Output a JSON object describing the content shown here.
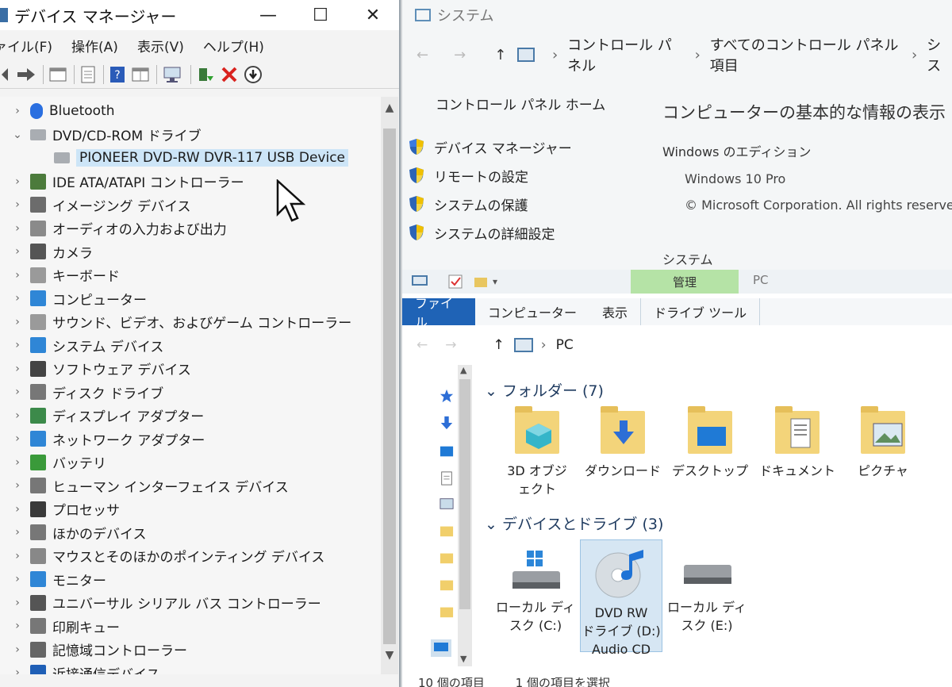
{
  "device_manager": {
    "title": "デバイス マネージャー",
    "window_buttons": {
      "minimize": "—",
      "maximize": "☐",
      "close": "✕"
    },
    "menu": [
      "ァイル(F)",
      "操作(A)",
      "表示(V)",
      "ヘルプ(H)"
    ],
    "tree_items": [
      {
        "label": "Bluetooth",
        "expanded": false,
        "icon": "bluetooth-icon"
      },
      {
        "label": "DVD/CD-ROM ドライブ",
        "expanded": true,
        "icon": "dvd-drive-icon"
      },
      {
        "label": "PIONEER DVD-RW  DVR-117 USB Device",
        "child": true,
        "selected": true,
        "icon": "dvd-drive-icon"
      },
      {
        "label": "IDE ATA/ATAPI コントローラー",
        "icon": "ide-controller-icon"
      },
      {
        "label": "イメージング デバイス",
        "icon": "imaging-device-icon"
      },
      {
        "label": "オーディオの入力および出力",
        "icon": "speaker-icon"
      },
      {
        "label": "カメラ",
        "icon": "camera-icon"
      },
      {
        "label": "キーボード",
        "icon": "keyboard-icon"
      },
      {
        "label": "コンピューター",
        "icon": "computer-icon"
      },
      {
        "label": "サウンド、ビデオ、およびゲーム コントローラー",
        "icon": "sound-icon"
      },
      {
        "label": "システム デバイス",
        "icon": "system-device-icon"
      },
      {
        "label": "ソフトウェア デバイス",
        "icon": "software-device-icon"
      },
      {
        "label": "ディスク ドライブ",
        "icon": "disk-drive-icon"
      },
      {
        "label": "ディスプレイ アダプター",
        "icon": "display-adapter-icon"
      },
      {
        "label": "ネットワーク アダプター",
        "icon": "network-adapter-icon"
      },
      {
        "label": "バッテリ",
        "icon": "battery-icon"
      },
      {
        "label": "ヒューマン インターフェイス デバイス",
        "icon": "hid-icon"
      },
      {
        "label": "プロセッサ",
        "icon": "processor-icon"
      },
      {
        "label": "ほかのデバイス",
        "icon": "other-device-icon"
      },
      {
        "label": "マウスとそのほかのポインティング デバイス",
        "icon": "mouse-icon"
      },
      {
        "label": "モニター",
        "icon": "monitor-icon"
      },
      {
        "label": "ユニバーサル シリアル バス コントローラー",
        "icon": "usb-icon"
      },
      {
        "label": "印刷キュー",
        "icon": "printer-icon"
      },
      {
        "label": "記憶域コントローラー",
        "icon": "storage-controller-icon"
      },
      {
        "label": "近接通信デバイス",
        "icon": "proximity-device-icon"
      }
    ]
  },
  "system_window": {
    "title": "システム",
    "breadcrumb": [
      "コントロール パネル",
      "すべてのコントロール パネル項目",
      "シス"
    ],
    "home_link": "コントロール パネル ホーム",
    "links": [
      "デバイス マネージャー",
      "リモートの設定",
      "システムの保護",
      "システムの詳細設定"
    ],
    "heading": "コンピューターの基本的な情報の表示",
    "edition_label": "Windows のエディション",
    "edition": "Windows 10 Pro",
    "copyright": "© Microsoft Corporation. All rights reserved.",
    "system_label": "システム"
  },
  "explorer": {
    "manage_tab": "管理",
    "pc_label": "PC",
    "ribbon_tabs": [
      "ファイル",
      "コンピューター",
      "表示",
      "ドライブ ツール"
    ],
    "address": "PC",
    "folders_title": "フォルダー (7)",
    "folders": [
      "3D オブジェクト",
      "ダウンロード",
      "デスクトップ",
      "ドキュメント",
      "ピクチャ"
    ],
    "devices_title": "デバイスとドライブ (3)",
    "drives": [
      {
        "line1": "ローカル ディ",
        "line2": "スク (C:)"
      },
      {
        "line1": "DVD RW",
        "line2": "ドライブ (D:)",
        "line3": "Audio CD"
      },
      {
        "line1": "ローカル ディ",
        "line2": "スク (E:)"
      }
    ],
    "status": [
      "10 個の項目",
      "1 個の項目を選択"
    ]
  }
}
